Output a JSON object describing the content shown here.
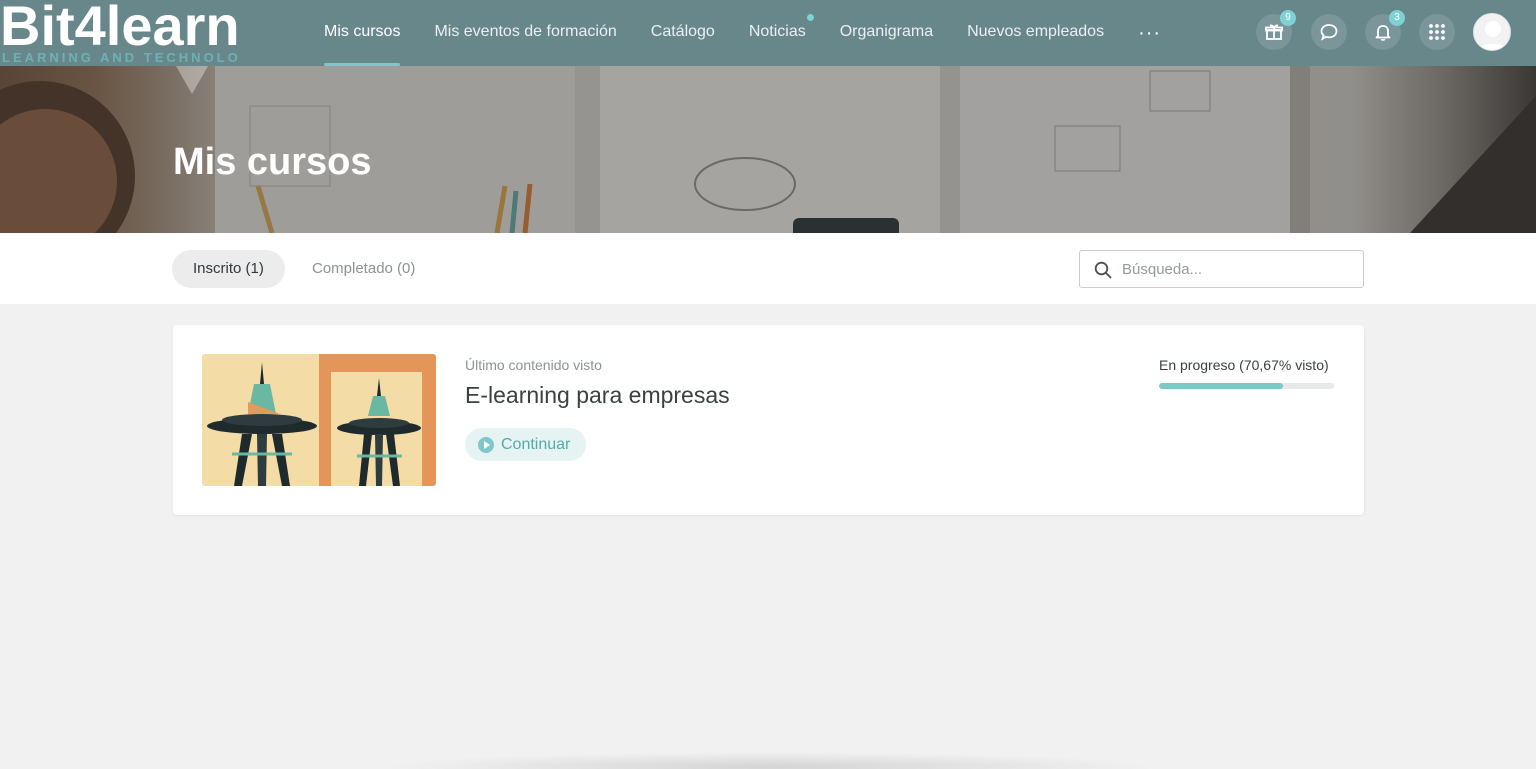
{
  "brand": {
    "name": "Bit4learn",
    "tagline": "LEARNING AND TECHNOLOGY"
  },
  "nav": {
    "items": [
      {
        "label": "Mis cursos",
        "active": true
      },
      {
        "label": "Mis eventos de formación",
        "active": false
      },
      {
        "label": "Catálogo",
        "active": false
      },
      {
        "label": "Noticias",
        "active": false,
        "has_dot": true
      },
      {
        "label": "Organigrama",
        "active": false
      },
      {
        "label": "Nuevos empleados",
        "active": false
      }
    ],
    "more_label": "···"
  },
  "header_icons": {
    "gift": {
      "icon": "gift-icon",
      "badge": "9"
    },
    "chat": {
      "icon": "chat-icon"
    },
    "notifications": {
      "icon": "bell-icon",
      "badge": "3"
    },
    "apps": {
      "icon": "grid-icon"
    },
    "avatar": {
      "icon": "user-avatar"
    }
  },
  "hero": {
    "title": "Mis cursos"
  },
  "filters": {
    "tabs": [
      {
        "label": "Inscrito (1)",
        "active": true
      },
      {
        "label": "Completado (0)",
        "active": false
      }
    ],
    "search": {
      "placeholder": "Búsqueda...",
      "value": ""
    }
  },
  "course": {
    "meta_label": "Último contenido visto",
    "title": "E-learning para empresas",
    "continue_label": "Continuar",
    "progress_label": "En progreso (70,67% visto)",
    "progress_percent": 70.67
  },
  "colors": {
    "topbar": "#68878b",
    "accent": "#7fc7c8",
    "page_bg": "#f1f1f1"
  }
}
